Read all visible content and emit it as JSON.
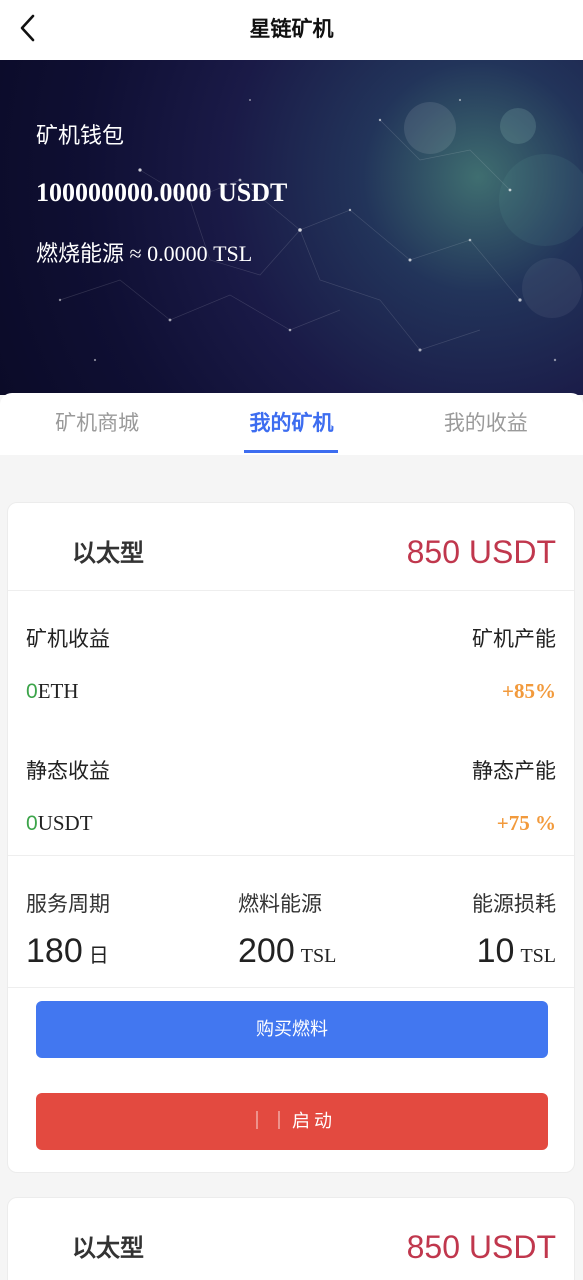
{
  "header": {
    "title": "星链矿机"
  },
  "wallet": {
    "label": "矿机钱包",
    "amount": "100000000.0000 USDT",
    "fuel": "燃烧能源 ≈ 0.0000 TSL"
  },
  "tabs": [
    {
      "label": "矿机商城",
      "active": false
    },
    {
      "label": "我的矿机",
      "active": true
    },
    {
      "label": "我的收益",
      "active": false
    }
  ],
  "cards": [
    {
      "name": "以太型",
      "price": "850 USDT",
      "mining_income_label": "矿机收益",
      "mining_income_zero": "0",
      "mining_income_unit": "ETH",
      "mining_capacity_label": "矿机产能",
      "mining_capacity_value": "+85%",
      "static_income_label": "静态收益",
      "static_income_zero": "0",
      "static_income_unit": "USDT",
      "static_capacity_label": "静态产能",
      "static_capacity_value": "+75 %",
      "service_label": "服务周期",
      "service_value": "180",
      "service_unit": "日",
      "fuel_label": "燃料能源",
      "fuel_value": "200",
      "fuel_unit": "TSL",
      "consume_label": "能源损耗",
      "consume_value": "10",
      "consume_unit": "TSL",
      "buy_button": "购买燃料",
      "start_button": "｜｜启动"
    },
    {
      "name": "以太型",
      "price": "850 USDT"
    }
  ],
  "icons": {
    "back": "chevron-left-icon"
  },
  "colors": {
    "accent": "#3d6df0",
    "price": "#c0374d",
    "buy": "#4277f0",
    "start": "#e34a40",
    "percent": "#f29a3c",
    "zero": "#3ca44a"
  }
}
